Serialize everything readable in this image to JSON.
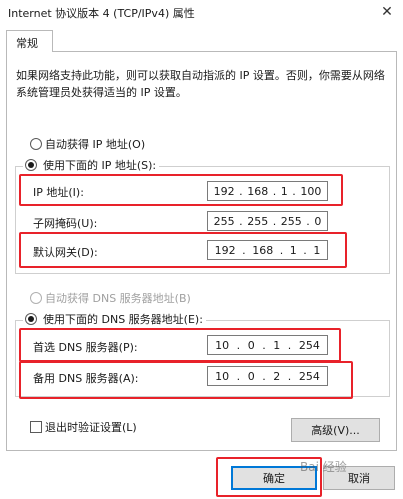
{
  "window": {
    "title": "Internet 协议版本 4 (TCP/IPv4) 属性",
    "close_glyph": "✕"
  },
  "tabs": [
    {
      "label": "常规"
    }
  ],
  "description": "如果网络支持此功能，则可以获取自动指派的 IP 设置。否则，你需要从网络系统管理员处获得适当的 IP 设置。",
  "ip_mode": {
    "auto_label": "自动获得 IP 地址(O)",
    "manual_label": "使用下面的 IP 地址(S):",
    "selected": "manual"
  },
  "ip_fields": {
    "ip_address": {
      "label": "IP 地址(I):",
      "octets": [
        "192",
        "168",
        "1",
        "100"
      ]
    },
    "subnet_mask": {
      "label": "子网掩码(U):",
      "octets": [
        "255",
        "255",
        "255",
        "0"
      ]
    },
    "gateway": {
      "label": "默认网关(D):",
      "octets": [
        "192",
        "168",
        "1",
        "1"
      ]
    }
  },
  "dns_mode": {
    "auto_label": "自动获得 DNS 服务器地址(B)",
    "manual_label": "使用下面的 DNS 服务器地址(E):",
    "selected": "manual"
  },
  "dns_fields": {
    "preferred": {
      "label": "首选 DNS 服务器(P):",
      "octets": [
        "10",
        "0",
        "1",
        "254"
      ]
    },
    "alternate": {
      "label": "备用 DNS 服务器(A):",
      "octets": [
        "10",
        "0",
        "2",
        "254"
      ]
    }
  },
  "validate_on_exit": {
    "label": "退出时验证设置(L)",
    "checked": false
  },
  "buttons": {
    "advanced": "高级(V)...",
    "ok": "确定",
    "cancel": "取消"
  },
  "watermark": "Bai 经验",
  "colors": {
    "highlight": "#e8222a",
    "primary_border": "#0078d7"
  }
}
